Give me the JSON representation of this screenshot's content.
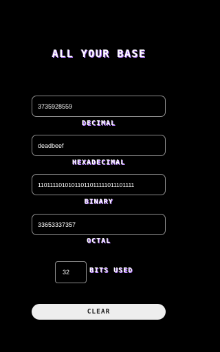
{
  "app": {
    "title": "ALL YOUR BASE"
  },
  "fields": {
    "decimal": {
      "value": "3735928559",
      "label": "DECIMAL"
    },
    "hexadecimal": {
      "value": "deadbeef",
      "label": "HEXADECIMAL"
    },
    "binary": {
      "value": "11011110101011011011111011101111",
      "label": "BINARY"
    },
    "octal": {
      "value": "33653337357",
      "label": "OCTAL"
    }
  },
  "bits": {
    "value": "32",
    "label": "BITS USED"
  },
  "actions": {
    "clear_label": "CLEAR"
  },
  "colors": {
    "background": "#000000",
    "text": "#ffffff",
    "label_shadow": "#b57cff",
    "field_border": "#8f8f8f",
    "button_bg": "#eeeeee"
  }
}
